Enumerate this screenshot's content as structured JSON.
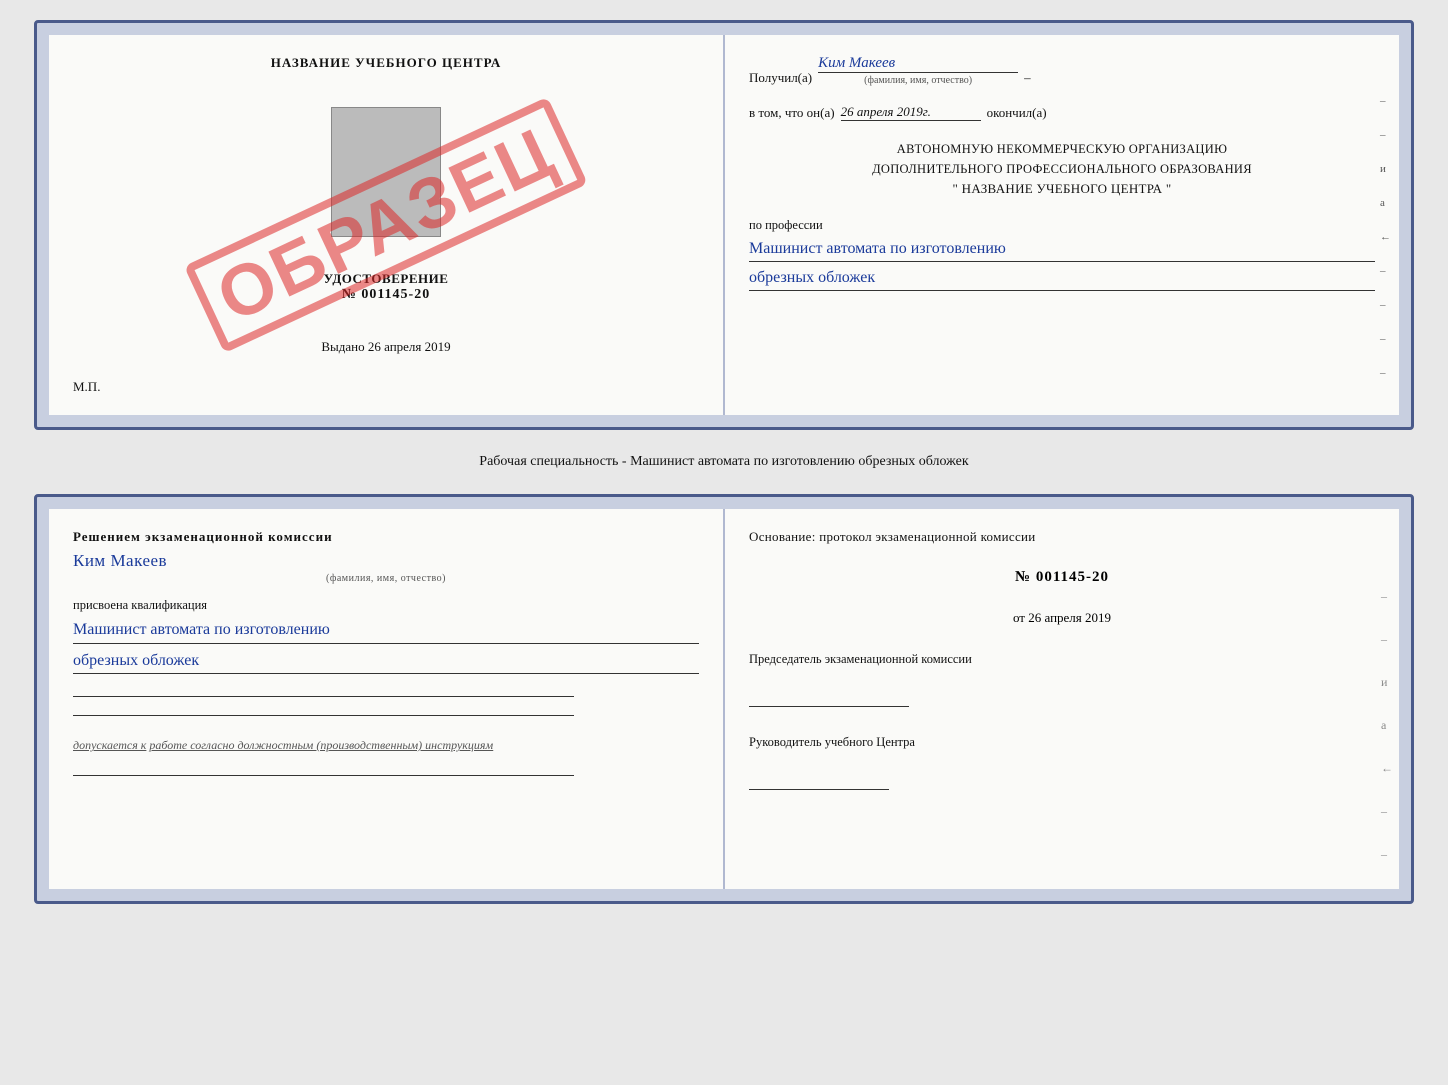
{
  "top_document": {
    "left": {
      "learning_center_title": "НАЗВАНИЕ УЧЕБНОГО ЦЕНТРА",
      "stamp_text": "ОБРАЗЕЦ",
      "udostoverenie_label": "УДОСТОВЕРЕНИЕ",
      "udostoverenie_num": "№ 001145-20",
      "vydano_label": "Выдано",
      "vydano_date": "26 апреля 2019",
      "mp_label": "М.П."
    },
    "right": {
      "poluchil_label": "Получил(а)",
      "poluchil_name": "Ким Макеев",
      "fio_note": "(фамилия, имя, отчество)",
      "vtom_label": "в том, что он(а)",
      "vtom_date": "26 апреля 2019г.",
      "okonchil_label": "окончил(а)",
      "org_line1": "АВТОНОМНУЮ НЕКОММЕРЧЕСКУЮ ОРГАНИЗАЦИЮ",
      "org_line2": "ДОПОЛНИТЕЛЬНОГО ПРОФЕССИОНАЛЬНОГО ОБРАЗОВАНИЯ",
      "org_name": "\" НАЗВАНИЕ УЧЕБНОГО ЦЕНТРА \"",
      "po_professii_label": "по профессии",
      "profession_line1": "Машинист автомата по изготовлению",
      "profession_line2": "обрезных обложек"
    }
  },
  "description": {
    "text": "Рабочая специальность - Машинист автомата по изготовлению обрезных обложек"
  },
  "bottom_document": {
    "left": {
      "resheniem_label": "Решением экзаменационной комиссии",
      "person_name": "Ким Макеев",
      "fio_note": "(фамилия, имя, отчество)",
      "prisvoena_label": "присвоена квалификация",
      "qualification_line1": "Машинист автомата по изготовлению",
      "qualification_line2": "обрезных обложек",
      "dopuskaetsya_label": "допускается к",
      "dopuskaetsya_text": "работе согласно должностным (производственным) инструкциям"
    },
    "right": {
      "osnovanie_label": "Основание: протокол экзаменационной комиссии",
      "protocol_num": "№ 001145-20",
      "ot_label": "от",
      "ot_date": "26 апреля 2019",
      "predsedatel_label": "Председатель экзаменационной комиссии",
      "rukovoditel_label": "Руководитель учебного Центра"
    }
  },
  "decorations": {
    "right_side_chars": [
      "–",
      "–",
      "и",
      "а",
      "←",
      "–",
      "–",
      "–",
      "–"
    ]
  }
}
